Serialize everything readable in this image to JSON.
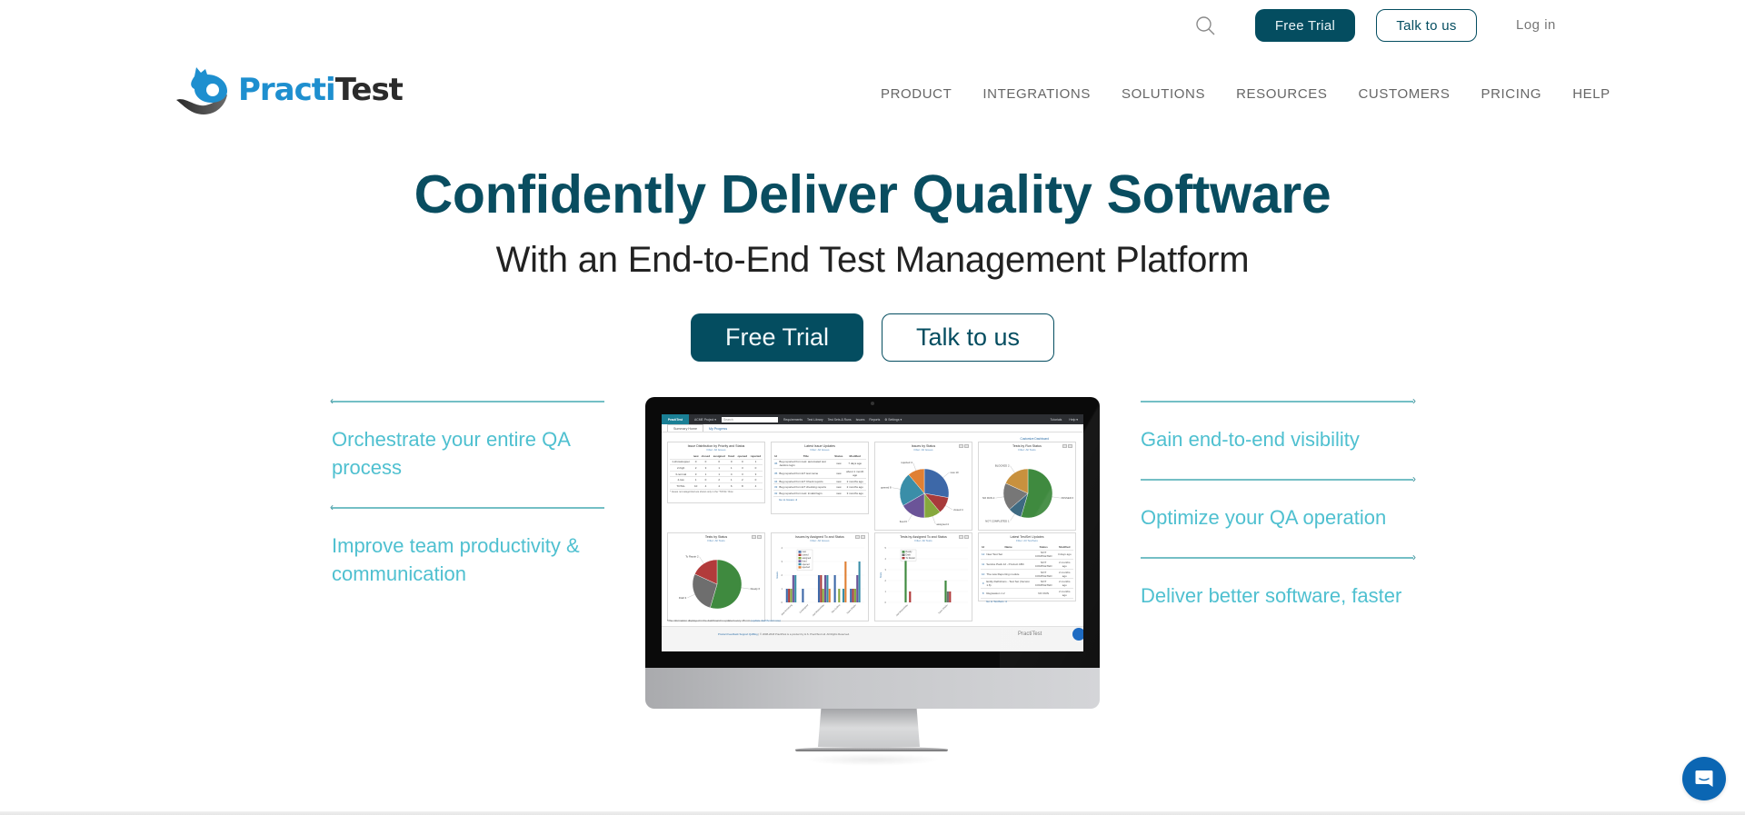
{
  "topbar": {
    "search_icon": "search-icon",
    "free_trial_label": "Free Trial",
    "talk_label": "Talk to us",
    "login_label": "Log in"
  },
  "logo": {
    "part1": "Practi",
    "part2": "Test",
    "icon": "fox-logo-icon",
    "brand_color": "#1e8fcf"
  },
  "nav": {
    "items": [
      {
        "label": "PRODUCT"
      },
      {
        "label": "INTEGRATIONS"
      },
      {
        "label": "SOLUTIONS"
      },
      {
        "label": "RESOURCES"
      },
      {
        "label": "CUSTOMERS"
      },
      {
        "label": "PRICING"
      },
      {
        "label": "HELP"
      }
    ]
  },
  "hero": {
    "title": "Confidently Deliver Quality Software",
    "subtitle": "With an End-to-End Test Management Platform",
    "cta_primary": "Free Trial",
    "cta_secondary": "Talk to us",
    "primary_color": "#044d60"
  },
  "features": {
    "left": [
      {
        "text": "Orchestrate your entire QA process"
      },
      {
        "text": "Improve team productivity & communication"
      }
    ],
    "right": [
      {
        "text": "Gain end-to-end visibility"
      },
      {
        "text": "Optimize your QA operation"
      },
      {
        "text": "Deliver better software, faster"
      }
    ],
    "text_color": "#4fc0d0",
    "line_color": "#74bfc5"
  },
  "app": {
    "logo": "PractiTest",
    "project": "ACME Project ▾",
    "search_placeholder": "Search",
    "menu": [
      "Requirements",
      "Test Library",
      "Test Sets & Runs",
      "Issues",
      "Reports",
      "⚙ Settings ▾"
    ],
    "right_menu": [
      "Tutorials",
      "Help ▾"
    ],
    "tabs": [
      "Summary Home",
      "My Progress"
    ],
    "customize": "Customize Dashboard",
    "widgets": {
      "issue_dist": {
        "title": "Issue Distribution by Priority and Status",
        "filter": "Filter: All Issues",
        "columns": [
          "",
          "new",
          "closed",
          "assigned",
          "fixed",
          "opened",
          "rejected"
        ],
        "rows": [
          [
            "1-showstopper",
            "0",
            "0",
            "0",
            "0",
            "0",
            "1"
          ],
          [
            "2-high",
            "2",
            "3",
            "1",
            "1",
            "3",
            "0"
          ],
          [
            "3-normal",
            "3",
            "1",
            "1",
            "4",
            "3",
            "3"
          ],
          [
            "4-low",
            "1",
            "0",
            "2",
            "1",
            "2",
            "0"
          ],
          [
            "TOTAL",
            "10",
            "4",
            "4",
            "6",
            "8",
            "4"
          ]
        ],
        "note": "* Issues not categorized are shown only in the \"TOTAL\" Row"
      },
      "latest_issues": {
        "title": "Latest Issue Updates",
        "filter": "Filter: All Issues",
        "columns": [
          "Id",
          "Title",
          "Status",
          "Modified"
        ],
        "rows": [
          [
            "36",
            "Bug reported from test: automated test Jenkins login",
            "new",
            "7 days ago"
          ],
          [
            "35",
            "Bug reported from ET test name",
            "new",
            "about 1 month ago"
          ],
          [
            "34",
            "Bug reported from ET Check reports",
            "new",
            "2 months ago"
          ],
          [
            "33",
            "Bug reported from ET checking reports",
            "new",
            "2 months ago"
          ],
          [
            "32",
            "Bug reported from test: invalid login",
            "new",
            "3 months ago"
          ]
        ],
        "footer": "Go to Issues ➜"
      },
      "latest_testsets": {
        "title": "Latest TestSet Updates",
        "filter": "Filter: All TestSets",
        "columns": [
          "Id",
          "Name",
          "Status",
          "Modified"
        ],
        "rows": [
          [
            "12",
            "New Test Set",
            "NOT COMPLETED",
            "3 days ago"
          ],
          [
            "11",
            "Service Pack 12 - Product ABC",
            "NOT COMPLETED",
            "2 months ago"
          ],
          [
            "10",
            "The new Reporting module",
            "NOT COMPLETED",
            "2 months ago"
          ],
          [
            "9",
            "Entity Definitions - Test Set (Version 1.6)",
            "NOT COMPLETED",
            "2 months ago"
          ],
          [
            "8",
            "Regression 1.2",
            "NO RUN",
            "2 months ago"
          ]
        ],
        "footer": "Go to TestSets ➜"
      }
    },
    "dashboard_note": "*The information displayed in the dashboard is updated every 15 min",
    "dashboard_note_link": "(update dashboard now)",
    "footer_links": "Product Feedback   Support   QABlog",
    "footer_copy": "|  © 2008-2018 PractiTest is a product by H.S. PractiTest Ltd. All Rights Reserved.",
    "footer_logo": "PractiTest"
  },
  "chart_data": [
    {
      "type": "pie",
      "title": "Issues by Status",
      "subtitle": "Filter: All Issues",
      "categories": [
        "new",
        "closed",
        "assigned",
        "fixed",
        "opened",
        "rejected"
      ],
      "values": [
        10,
        4,
        4,
        6,
        8,
        4
      ],
      "colors": [
        "#3d68a8",
        "#a83b3b",
        "#86a83d",
        "#6b5498",
        "#3a8ea8",
        "#e08034"
      ]
    },
    {
      "type": "pie",
      "title": "Tests by Run Status",
      "subtitle": "Filter: All Tests",
      "categories": [
        "PASSED",
        "NOT COMPLETED",
        "NO RUN",
        "BLOCKED"
      ],
      "values": [
        6,
        1,
        2,
        2
      ],
      "colors": [
        "#3f8a3f",
        "#3e6a82",
        "#777777",
        "#c8913e"
      ]
    },
    {
      "type": "pie",
      "title": "Tests by Status",
      "subtitle": "Filter: All Tests",
      "categories": [
        "Ready",
        "Draft",
        "To Repair"
      ],
      "values": [
        6,
        3,
        2
      ],
      "colors": [
        "#3f8a3f",
        "#6e6e6e",
        "#b23b3b"
      ]
    },
    {
      "type": "bar",
      "title": "Issues by Assigned To and Status",
      "subtitle": "Filter: All Issues",
      "ylabel": "Issues",
      "ylim": [
        0,
        4
      ],
      "categories": [
        "Alex Armstrong",
        "Unassigned",
        "Joel Montvelisky",
        "Stev Collins",
        "Yaara Shalev"
      ],
      "series": [
        {
          "name": "new",
          "color": "#3d68a8",
          "values": [
            1,
            1,
            2,
            2,
            1
          ]
        },
        {
          "name": "closed",
          "color": "#a83b3b",
          "values": [
            1,
            0,
            2,
            0,
            1
          ]
        },
        {
          "name": "assigned",
          "color": "#86a83d",
          "values": [
            1,
            0,
            1,
            1,
            1
          ]
        },
        {
          "name": "fixed",
          "color": "#6b5498",
          "values": [
            2,
            0,
            2,
            0,
            2
          ]
        },
        {
          "name": "opened",
          "color": "#3a8ea8",
          "values": [
            2,
            0,
            2,
            1,
            3
          ]
        },
        {
          "name": "rejected",
          "color": "#e08034",
          "values": [
            0,
            0,
            1,
            3,
            0
          ]
        }
      ]
    },
    {
      "type": "bar",
      "title": "Tests by Assigned To and Status",
      "subtitle": "Filter: All Tests",
      "ylabel": "Tests",
      "ylim": [
        0,
        5
      ],
      "categories": [
        "Joel Montvelisky",
        "Yaara Shalev"
      ],
      "series": [
        {
          "name": "Ready",
          "color": "#3f8a3f",
          "values": [
            4,
            2
          ]
        },
        {
          "name": "Draft",
          "color": "#6e6e6e",
          "values": [
            0,
            1
          ]
        },
        {
          "name": "To Repair",
          "color": "#b23b3b",
          "values": [
            1,
            1
          ]
        }
      ]
    }
  ],
  "chat": {
    "icon": "chat-bubble-icon",
    "color": "#0b66b3"
  }
}
